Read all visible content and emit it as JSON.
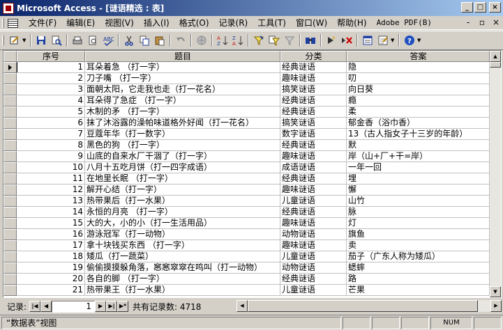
{
  "window": {
    "title": "Microsoft Access - [谜语精选 : 表]",
    "min": "_",
    "max": "□",
    "close": "×"
  },
  "menu": {
    "items": [
      "文件(F)",
      "编辑(E)",
      "视图(V)",
      "插入(I)",
      "格式(O)",
      "记录(R)",
      "工具(T)",
      "窗口(W)",
      "帮助(H)",
      "Adobe PDF(B)"
    ],
    "mdi": {
      "min": "-",
      "restore": "▫",
      "close": "×"
    }
  },
  "toolbar": {
    "icons": [
      "view-icon",
      "save-icon",
      "search-icon",
      "print-icon",
      "print-preview-icon",
      "spelling-icon",
      "cut-icon",
      "copy-icon",
      "paste-icon",
      "undo-icon",
      "hyperlink-icon",
      "sort-ascending-icon",
      "sort-descending-icon",
      "filter-by-selection-icon",
      "filter-by-form-icon",
      "apply-filter-icon",
      "find-icon",
      "new-record-icon",
      "delete-record-icon",
      "database-window-icon",
      "new-object-icon",
      "help-icon"
    ]
  },
  "table": {
    "columns": [
      "序号",
      "题目",
      "分类",
      "答案"
    ],
    "rows": [
      {
        "id": "1",
        "q": "耳朵着急 （打一字）",
        "cat": "经典谜语",
        "ans": "隐"
      },
      {
        "id": "2",
        "q": "刀子嘴 （打一字）",
        "cat": "趣味谜语",
        "ans": "叨"
      },
      {
        "id": "3",
        "q": "面朝太阳，它走我也走（打一花名）",
        "cat": "搞笑谜语",
        "ans": "向日葵"
      },
      {
        "id": "4",
        "q": "耳朵得了急症 （打一字）",
        "cat": "经典谜语",
        "ans": "瘾"
      },
      {
        "id": "5",
        "q": "木制的矛 （打一字）",
        "cat": "经典谜语",
        "ans": "柔"
      },
      {
        "id": "6",
        "q": "抹了沐浴露的澡帕味道格外好闻（打一花名）",
        "cat": "搞笑谜语",
        "ans": "郁金香（浴巾香）"
      },
      {
        "id": "7",
        "q": "豆蔻年华（打一数字）",
        "cat": "数字谜语",
        "ans": "13（古人指女子十三岁的年龄）"
      },
      {
        "id": "8",
        "q": "黑色的狗 （打一字）",
        "cat": "经典谜语",
        "ans": "默"
      },
      {
        "id": "9",
        "q": "山底的自来水厂干涸了（打一字）",
        "cat": "趣味谜语",
        "ans": "岸（山+厂+干=岸）"
      },
      {
        "id": "10",
        "q": "八月十五吃月饼（打一四字成语）",
        "cat": "成语谜语",
        "ans": "一年一回"
      },
      {
        "id": "11",
        "q": "在地里长眠 （打一字）",
        "cat": "经典谜语",
        "ans": "埋"
      },
      {
        "id": "12",
        "q": "解开心结（打一字）",
        "cat": "趣味谜语",
        "ans": "懈"
      },
      {
        "id": "13",
        "q": "热带果后（打一水果）",
        "cat": "儿童谜语",
        "ans": "山竹"
      },
      {
        "id": "14",
        "q": "永恒的月亮 （打一字）",
        "cat": "经典谜语",
        "ans": "脉"
      },
      {
        "id": "15",
        "q": "大的大，小的小（打一生活用品）",
        "cat": "趣味谜语",
        "ans": "灯"
      },
      {
        "id": "16",
        "q": "游泳冠军（打一动物）",
        "cat": "动物谜语",
        "ans": "旗鱼"
      },
      {
        "id": "17",
        "q": "拿十块钱买东西 （打一字）",
        "cat": "趣味谜语",
        "ans": "卖"
      },
      {
        "id": "18",
        "q": "矮瓜（打一蔬菜）",
        "cat": "儿童谜语",
        "ans": "茄子（广东人称为矮瓜）"
      },
      {
        "id": "19",
        "q": "偷偷摸摸躲角落，窸窸窣窣在鸣叫（打一动物）",
        "cat": "动物谜语",
        "ans": "蟋蟀"
      },
      {
        "id": "20",
        "q": "各自的脚 （打一字）",
        "cat": "经典谜语",
        "ans": "路"
      },
      {
        "id": "21",
        "q": "热带果王（打一水果）",
        "cat": "儿童谜语",
        "ans": "芒果"
      }
    ]
  },
  "navigator": {
    "label": "记录:",
    "current": "1",
    "total_label": "共有记录数: 4718",
    "first": "|◀",
    "prev": "◀",
    "next": "▶",
    "last": "▶|",
    "new": "▶*"
  },
  "status": {
    "view": "“数据表”视图",
    "num": "NUM"
  }
}
